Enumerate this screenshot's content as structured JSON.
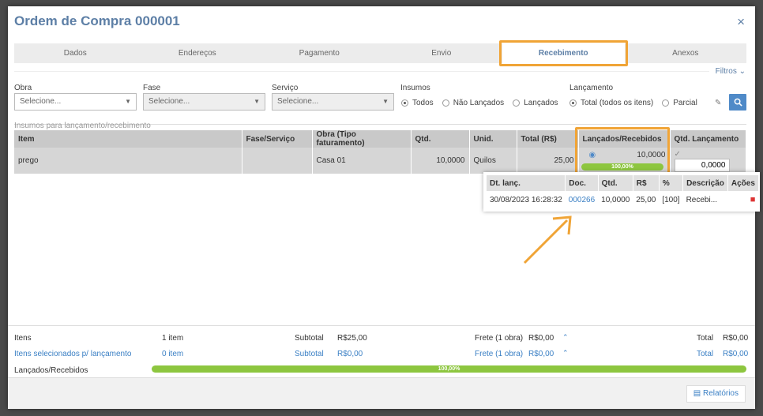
{
  "modal": {
    "title": "Ordem de Compra 000001",
    "close_icon": "×"
  },
  "tabs": [
    {
      "label": "Dados"
    },
    {
      "label": "Endereços"
    },
    {
      "label": "Pagamento"
    },
    {
      "label": "Envio"
    },
    {
      "label": "Recebimento",
      "active": true
    },
    {
      "label": "Anexos"
    }
  ],
  "filters": {
    "toggle_label": "Filtros",
    "obra": {
      "label": "Obra",
      "placeholder": "Selecione..."
    },
    "fase": {
      "label": "Fase",
      "placeholder": "Selecione..."
    },
    "servico": {
      "label": "Serviço",
      "placeholder": "Selecione..."
    },
    "insumos": {
      "label": "Insumos",
      "options": [
        "Todos",
        "Não Lançados",
        "Lançados"
      ],
      "selected": "Todos"
    },
    "lancamento": {
      "label": "Lançamento",
      "options": [
        "Total (todos os itens)",
        "Parcial"
      ],
      "selected": "Total (todos os itens)"
    }
  },
  "section_label": "Insumos para lançamento/recebimento",
  "table": {
    "headers": [
      "Item",
      "Fase/Serviço",
      "Obra (Tipo faturamento)",
      "Qtd.",
      "Unid.",
      "Total (R$)",
      "Lançados/Recebidos",
      "Qtd. Lançamento"
    ],
    "row": {
      "item": "prego",
      "fase_servico": "",
      "obra": "Casa 01",
      "qtd": "10,0000",
      "unid": "Quilos",
      "total": "25,00",
      "lancados": "10,0000",
      "progress_label": "100,00%",
      "progress": 1.0,
      "qtd_lancamento": "0,0000"
    }
  },
  "popover": {
    "headers": [
      "Dt. lanç.",
      "Doc.",
      "Qtd.",
      "R$",
      "%",
      "Descrição",
      "Ações"
    ],
    "row": {
      "data": "30/08/2023 16:28:32",
      "doc": "000266",
      "qtd": "10,0000",
      "valor": "25,00",
      "pct": "[100]",
      "descricao": "Recebi..."
    }
  },
  "footer": {
    "itens_label": "Itens",
    "itens_count": "1 item",
    "subtotal_label": "Subtotal",
    "subtotal_value": "R$25,00",
    "frete_label": "Frete (1 obra)",
    "frete_value": "R$0,00",
    "total_label": "Total",
    "total_value": "R$0,00",
    "sel_label": "Itens selecionados p/ lançamento",
    "sel_count": "0 item",
    "sel_subtotal_label": "Subtotal",
    "sel_subtotal_value": "R$0,00",
    "sel_frete_label": "Frete (1 obra)",
    "sel_frete_value": "R$0,00",
    "sel_total_label": "Total",
    "sel_total_value": "R$0,00",
    "lancados_label": "Lançados/Recebidos",
    "progress_label": "100,00%",
    "progress": 1.0
  },
  "actions": {
    "relatorios": "Relatórios"
  },
  "colors": {
    "accent": "#5d7fa6",
    "highlight": "#f0a436",
    "progress": "#8dc63f",
    "link": "#3a7fc4"
  }
}
